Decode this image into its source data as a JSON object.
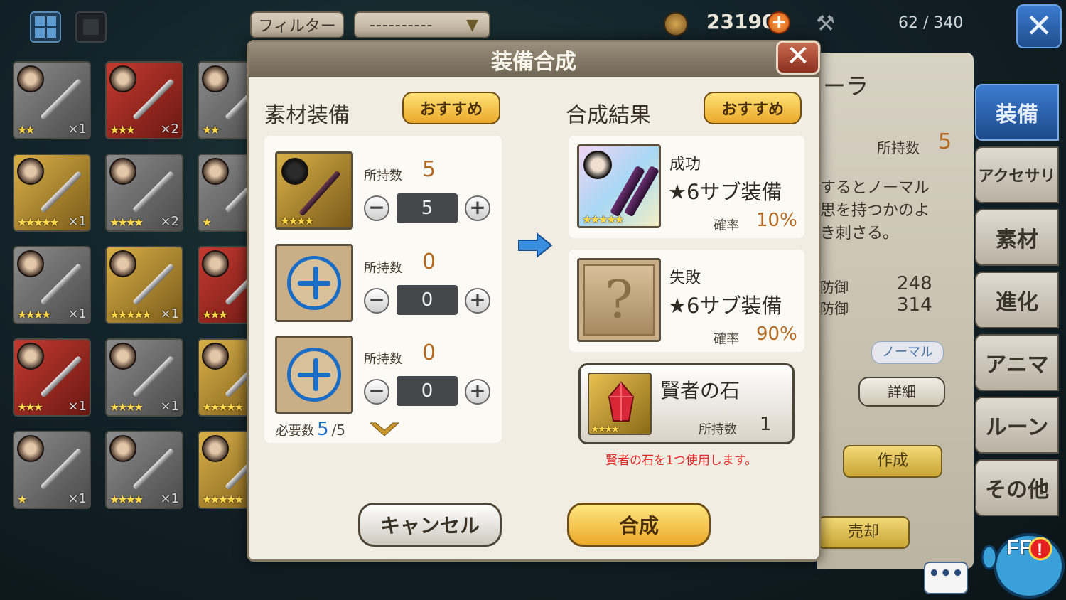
{
  "top": {
    "filter_label": "フィルター",
    "filter_value": "----------",
    "gil": "23190",
    "inventory": "62 / 340"
  },
  "grid": [
    {
      "stars": "★★",
      "count": "×1",
      "bg": "gray"
    },
    {
      "stars": "★★★",
      "count": "×2",
      "bg": "red"
    },
    {
      "stars": "★★",
      "count": "",
      "bg": "gray"
    },
    {
      "stars": "★★★★★",
      "count": "×1",
      "bg": "gold"
    },
    {
      "stars": "★★★★",
      "count": "×2",
      "bg": "gray"
    },
    {
      "stars": "★",
      "count": "",
      "bg": "gray"
    },
    {
      "stars": "★★★★",
      "count": "×1",
      "bg": "gray"
    },
    {
      "stars": "★★★★★",
      "count": "×1",
      "bg": "gold"
    },
    {
      "stars": "★★★",
      "count": "",
      "bg": "red"
    },
    {
      "stars": "★★★",
      "count": "×1",
      "bg": "red"
    },
    {
      "stars": "★★★★",
      "count": "×1",
      "bg": "gray"
    },
    {
      "stars": "★★★★★",
      "count": "",
      "bg": "gold"
    },
    {
      "stars": "★",
      "count": "×1",
      "bg": "gray"
    },
    {
      "stars": "★★★★",
      "count": "×1",
      "bg": "gray"
    },
    {
      "stars": "★★★★★",
      "count": "",
      "bg": "gold"
    }
  ],
  "detail": {
    "title_frag": "ーラ",
    "owned_label": "所持数",
    "owned_value": "5",
    "desc1": "するとノーマル",
    "desc2": "思を持つかのよ",
    "desc3": "き刺さる。",
    "stat1_label": "防御",
    "stat1_value": "248",
    "stat2_label": "防御",
    "stat2_value": "314",
    "rarity": "ノーマル",
    "details_btn": "詳細",
    "create_btn": "作成",
    "sell_btn": "売却"
  },
  "tabs": [
    "装備",
    "アクセサリ",
    "素材",
    "進化",
    "アニマ",
    "ルーン",
    "その他"
  ],
  "modal": {
    "title": "装備合成",
    "left_title": "素材装備",
    "right_title": "合成結果",
    "recommend": "おすすめ",
    "owned_label": "所持数",
    "materials": [
      {
        "owned": "5",
        "qty": "5",
        "stars": "★★★★"
      },
      {
        "owned": "0",
        "qty": "0"
      },
      {
        "owned": "0",
        "qty": "0"
      }
    ],
    "required_label": "必要数",
    "required_current": "5",
    "required_total": "/5",
    "success": {
      "label": "成功",
      "item": "★6サブ装備",
      "rate_label": "確率",
      "rate": "10%",
      "stars": "★★★★★"
    },
    "fail": {
      "label": "失敗",
      "item": "★6サブ装備",
      "rate_label": "確率",
      "rate": "90%"
    },
    "stone": {
      "name": "賢者の石",
      "owned_label": "所持数",
      "owned": "1",
      "stars": "★★★★"
    },
    "note": "賢者の石を1つ使用します。",
    "cancel": "キャンセル",
    "synth": "合成"
  },
  "colors": {
    "accent_blue": "#1a6cc4",
    "gold": "#eba92a",
    "rate": "#b46a20",
    "warning": "#e02828"
  }
}
